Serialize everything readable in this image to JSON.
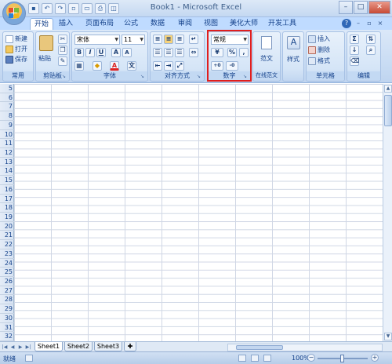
{
  "window": {
    "title": "Book1 - Microsoft Excel"
  },
  "qat": [
    "save",
    "undo",
    "redo",
    "new",
    "open",
    "print",
    "preview"
  ],
  "window_controls": {
    "minimize": "–",
    "maximize": "□",
    "close": "✕"
  },
  "tabs": [
    {
      "label": "开始",
      "active": true
    },
    {
      "label": "插入"
    },
    {
      "label": "页面布局"
    },
    {
      "label": "公式"
    },
    {
      "label": "数据"
    },
    {
      "label": "审阅"
    },
    {
      "label": "视图"
    },
    {
      "label": "美化大师"
    },
    {
      "label": "开发工具"
    }
  ],
  "ribbon": {
    "common": {
      "label": "常用",
      "new": "新建",
      "open": "打开",
      "save": "保存"
    },
    "clipboard": {
      "label": "剪贴板",
      "paste": "粘贴"
    },
    "font": {
      "label": "字体",
      "name": "宋体",
      "size": "11",
      "bold": "B",
      "italic": "I",
      "underline": "U",
      "grow": "A",
      "shrink": "A",
      "color_letter": "A"
    },
    "alignment": {
      "label": "对齐方式"
    },
    "number": {
      "label": "数字",
      "format": "常规",
      "percent": "%",
      "comma": ",",
      "inc_dec": ".0→.00",
      "dec_dec": ".00→.0"
    },
    "template": {
      "label": "在线范文",
      "button": "范文"
    },
    "styles": {
      "button": "样式"
    },
    "cells": {
      "label": "单元格",
      "insert": "插入",
      "delete": "删除",
      "format": "格式"
    },
    "editing": {
      "label": "编辑",
      "sum": "Σ"
    }
  },
  "grid": {
    "rows": [
      "5",
      "6",
      "7",
      "8",
      "9",
      "10",
      "11",
      "12",
      "13",
      "14",
      "15",
      "16",
      "17",
      "18",
      "19",
      "20",
      "21",
      "22",
      "23",
      "24",
      "25",
      "26",
      "27",
      "28",
      "29",
      "30",
      "31",
      "32"
    ]
  },
  "sheets": [
    {
      "label": "Sheet1",
      "active": true
    },
    {
      "label": "Sheet2"
    },
    {
      "label": "Sheet3"
    }
  ],
  "status": {
    "ready": "就绪",
    "zoom": "100%",
    "zoom_level": 0.5
  }
}
